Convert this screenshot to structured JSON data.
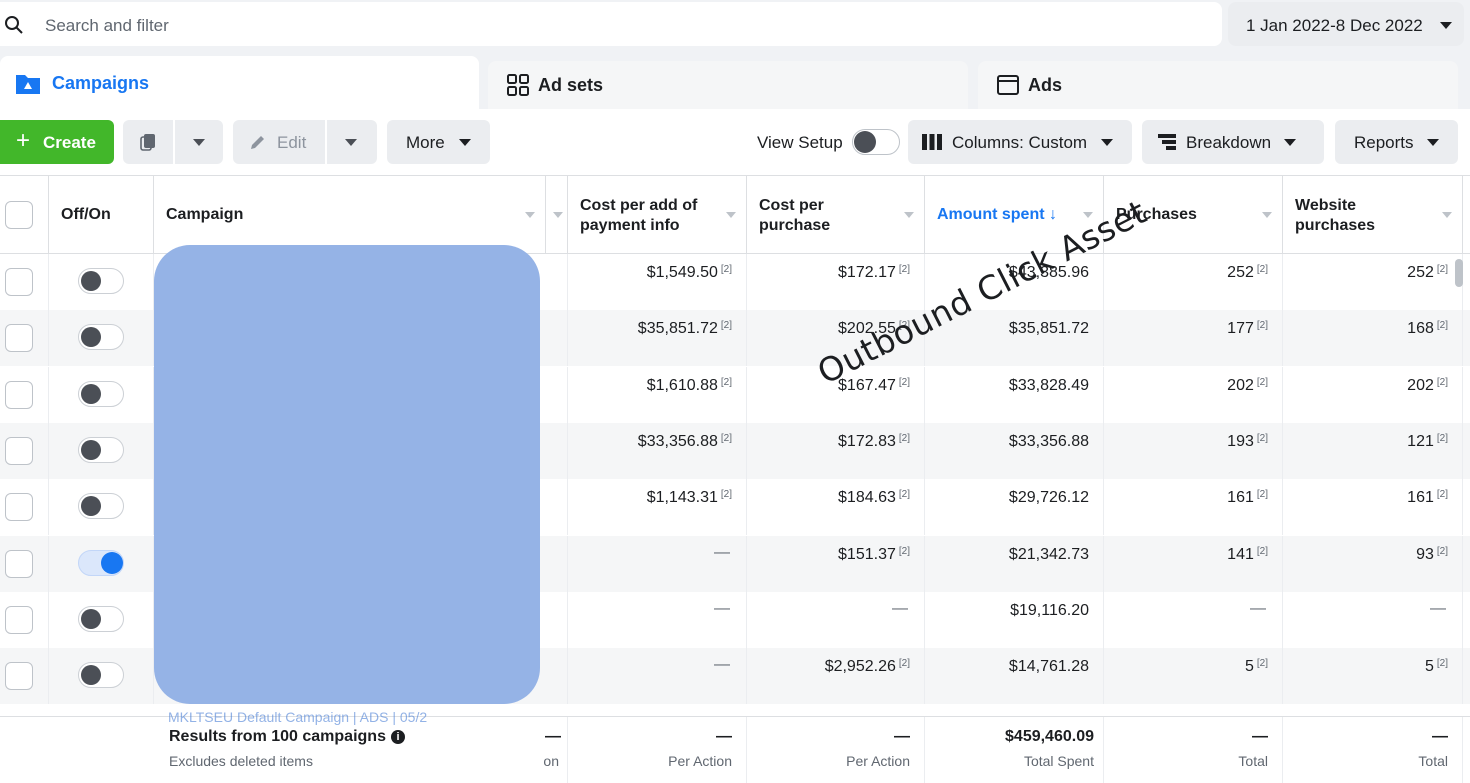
{
  "search": {
    "placeholder": "Search and filter",
    "icon": "search-icon"
  },
  "date_range": {
    "label": "1 Jan 2022-8 Dec 2022"
  },
  "tabs": [
    {
      "label": "Campaigns",
      "icon": "campaign-folder-icon",
      "active": true
    },
    {
      "label": "Ad sets",
      "icon": "grid-icon",
      "active": false
    },
    {
      "label": "Ads",
      "icon": "ad-window-icon",
      "active": false
    }
  ],
  "toolbar": {
    "create_label": "Create",
    "edit_label": "Edit",
    "more_label": "More",
    "view_setup_label": "View Setup",
    "columns_label": "Columns: Custom",
    "breakdown_label": "Breakdown",
    "reports_label": "Reports"
  },
  "columns": {
    "off_on": "Off/On",
    "campaign": "Campaign",
    "cost_per_add_payment": "Cost per add of payment info",
    "cost_per_purchase": "Cost per purchase",
    "amount_spent": "Amount spent ↓",
    "purchases": "Purchases",
    "website_purchases": "Website purchases"
  },
  "rows": [
    {
      "on": false,
      "cost_add_payment": "$1,549.50",
      "cost_purchase": "$172.17",
      "amount_spent": "$43,385.96",
      "purchases": "252",
      "website_purchases": "252"
    },
    {
      "on": false,
      "cost_add_payment": "$35,851.72",
      "cost_purchase": "$202.55",
      "amount_spent": "$35,851.72",
      "purchases": "177",
      "website_purchases": "168"
    },
    {
      "on": false,
      "cost_add_payment": "$1,610.88",
      "cost_purchase": "$167.47",
      "amount_spent": "$33,828.49",
      "purchases": "202",
      "website_purchases": "202"
    },
    {
      "on": false,
      "cost_add_payment": "$33,356.88",
      "cost_purchase": "$172.83",
      "amount_spent": "$33,356.88",
      "purchases": "193",
      "website_purchases": "121"
    },
    {
      "on": false,
      "cost_add_payment": "$1,143.31",
      "cost_purchase": "$184.63",
      "amount_spent": "$29,726.12",
      "purchases": "161",
      "website_purchases": "161"
    },
    {
      "on": true,
      "cost_add_payment": "",
      "cost_purchase": "$151.37",
      "amount_spent": "$21,342.73",
      "purchases": "141",
      "website_purchases": "93"
    },
    {
      "on": false,
      "cost_add_payment": "",
      "cost_purchase": "",
      "amount_spent": "$19,116.20",
      "purchases": "",
      "website_purchases": ""
    },
    {
      "on": false,
      "cost_add_payment": "",
      "cost_purchase": "$2,952.26",
      "amount_spent": "$14,761.28",
      "purchases": "5",
      "website_purchases": "5"
    }
  ],
  "superscript": "[2]",
  "dash": "—",
  "footer": {
    "results_label": "Results from 100 campaigns",
    "excludes_label": "Excludes deleted items",
    "peek_text": "MKLTSEU Default Campaign | ADS | 05/2",
    "cost_add_payment_sub": "Per Action",
    "cost_purchase_sub": "Per Action",
    "amount_spent_total": "$459,460.09",
    "amount_spent_sub": "Total Spent",
    "purchases_sub": "Total",
    "website_purchases_sub": "Total",
    "partial_sub": "on"
  },
  "watermark": "Outbound Click Asset",
  "colors": {
    "accent": "#1877f2",
    "create": "#42b72a",
    "redaction": "#95b3e6"
  }
}
